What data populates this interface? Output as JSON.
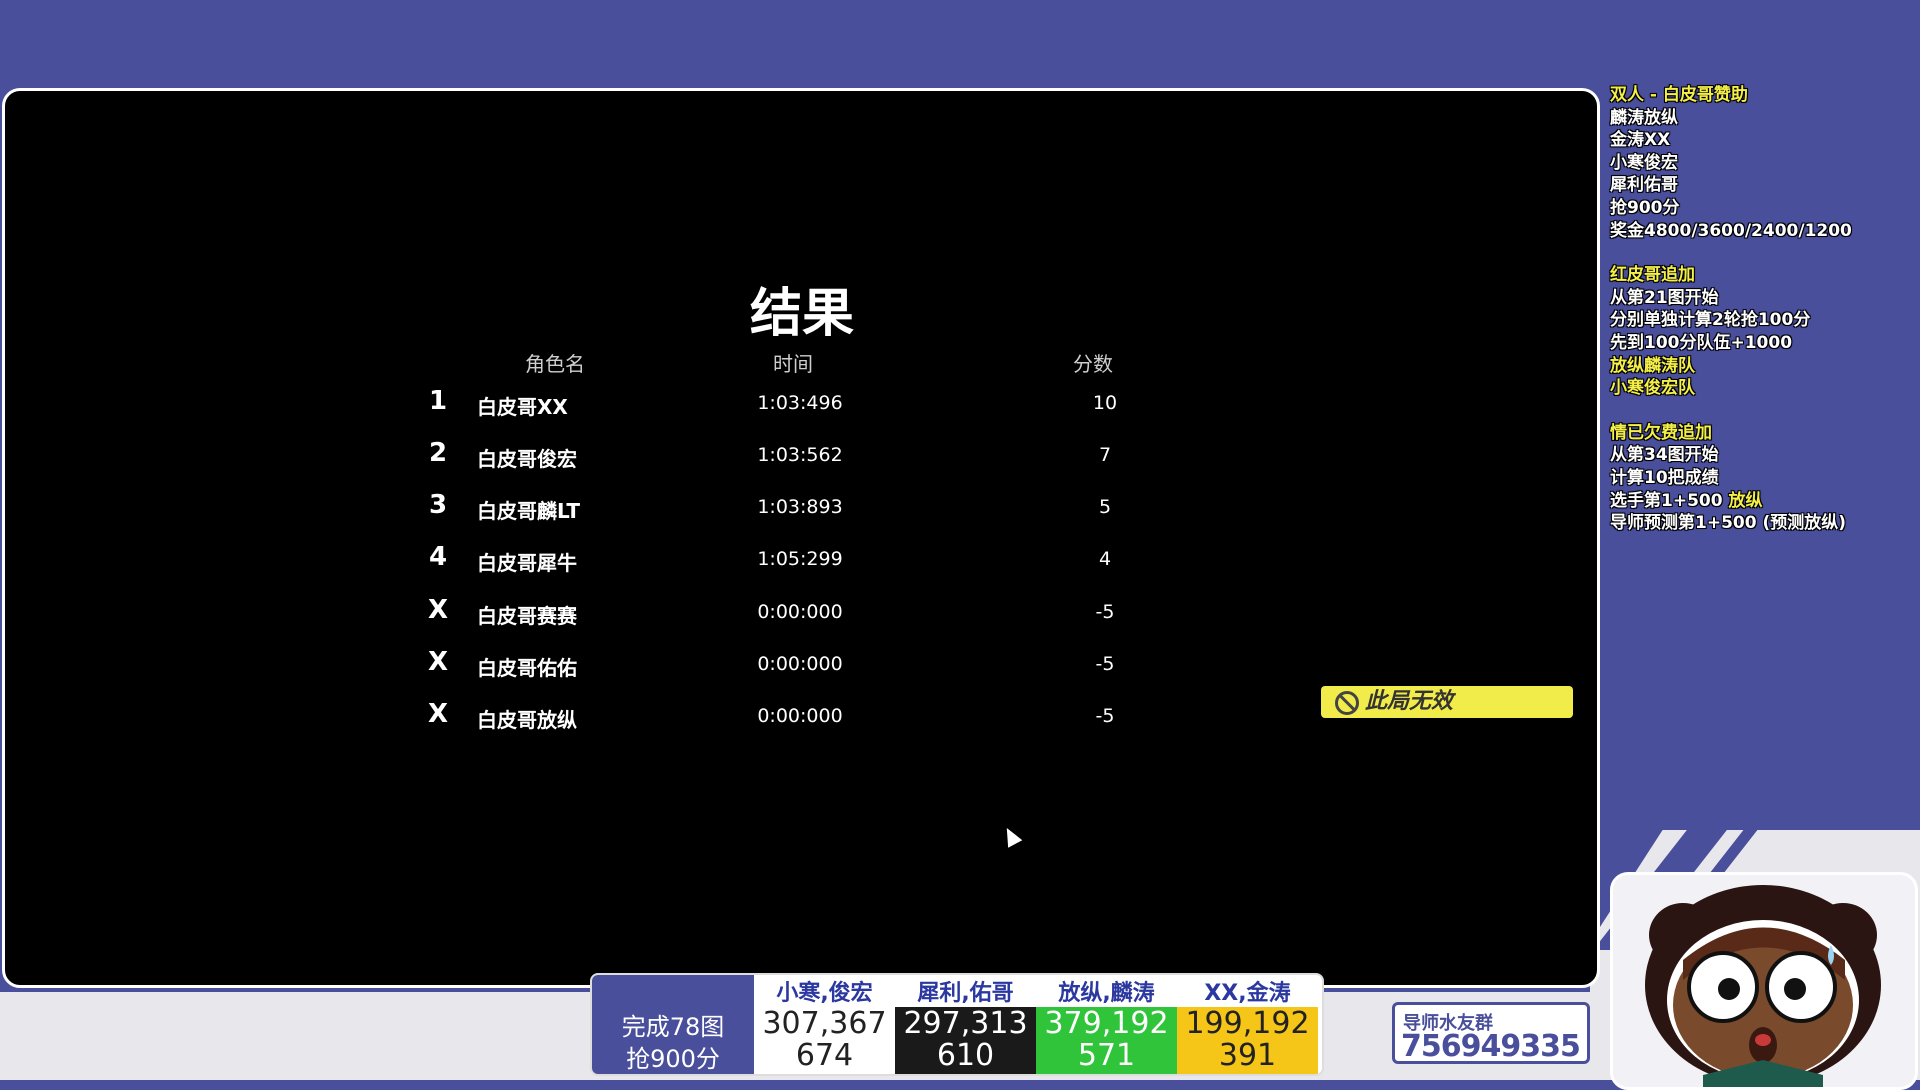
{
  "results": {
    "title": "结果",
    "headers": {
      "name": "角色名",
      "time": "时间",
      "score": "分数"
    },
    "rows": [
      {
        "rank": "1",
        "name": "白皮哥XX",
        "time": "1:03:496",
        "score": "10"
      },
      {
        "rank": "2",
        "name": "白皮哥俊宏",
        "time": "1:03:562",
        "score": "7"
      },
      {
        "rank": "3",
        "name": "白皮哥麟LT",
        "time": "1:03:893",
        "score": "5"
      },
      {
        "rank": "4",
        "name": "白皮哥犀牛",
        "time": "1:05:299",
        "score": "4"
      },
      {
        "rank": "X",
        "name": "白皮哥赛赛",
        "time": "0:00:000",
        "score": "-5"
      },
      {
        "rank": "X",
        "name": "白皮哥佑佑",
        "time": "0:00:000",
        "score": "-5"
      },
      {
        "rank": "X",
        "name": "白皮哥放纵",
        "time": "0:00:000",
        "score": "-5"
      }
    ]
  },
  "void_badge": {
    "label": "此局无效",
    "icon": "ban-icon",
    "color": "#f2ec4a"
  },
  "info": {
    "block1": {
      "title": "双人 - 白皮哥赞助",
      "lines": [
        "麟涛放纵",
        "金涛XX",
        "小寒俊宏",
        "犀利佑哥",
        "抢900分",
        "奖金4800/3600/2400/1200"
      ]
    },
    "block2": {
      "title": "红皮哥追加",
      "lines": [
        "从第21图开始",
        "分别单独计算2轮抢100分",
        "先到100分队伍+1000"
      ],
      "yellow_lines": [
        "放纵麟涛队",
        "小寒俊宏队"
      ]
    },
    "block3": {
      "title": "情已欠费追加",
      "lines": [
        "从第34图开始",
        "计算10把成绩"
      ],
      "line_pick_prefix": "选手第1+500 ",
      "line_pick_highlight": "放纵",
      "line_predict": "导师预测第1+500 (预测放纵)"
    }
  },
  "scoreboard": {
    "completed": "完成78图",
    "target": "抢900分",
    "teams": [
      {
        "name": "小寒,俊宏",
        "score": "307,367",
        "count": "674",
        "bg": "#ffffff",
        "fg": "#222222"
      },
      {
        "name": "犀利,佑哥",
        "score": "297,313",
        "count": "610",
        "bg": "#1a1a1a",
        "fg": "#ffffff"
      },
      {
        "name": "放纵,麟涛",
        "score": "379,192",
        "count": "571",
        "bg": "#2fc43a",
        "fg": "#ffffff"
      },
      {
        "name": "XX,金涛",
        "score": "199,192",
        "count": "391",
        "bg": "#f5c518",
        "fg": "#222222"
      }
    ]
  },
  "group": {
    "label": "导师水友群",
    "number": "756949335"
  },
  "colors": {
    "brand": "#4a4f9c",
    "highlight": "#f5f047"
  }
}
